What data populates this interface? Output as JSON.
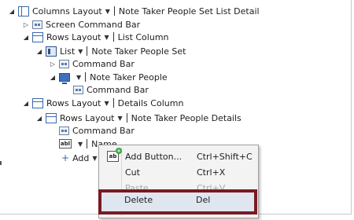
{
  "tree": {
    "root": {
      "icon": "columns-layout-icon",
      "control": "Columns Layout",
      "label": "Note Taker People Set List Detail"
    },
    "screen_command_bar": "Screen Command Bar",
    "rows1": {
      "control": "Rows Layout",
      "label": "List Column"
    },
    "list": {
      "control": "List",
      "label": "Note Taker People Set"
    },
    "list_command_bar": "Command Bar",
    "item": {
      "label": "Note Taker People"
    },
    "item_command_bar": "Command Bar",
    "rows2": {
      "control": "Rows Layout",
      "label": "Details Column"
    },
    "rows3": {
      "control": "Rows Layout",
      "label": "Note Taker People Details"
    },
    "details_command_bar": "Command Bar",
    "name_field": {
      "icon_text": "abl",
      "label": "Name"
    },
    "add": "Add"
  },
  "context_menu": {
    "items": [
      {
        "label": "Add Button...",
        "shortcut": "Ctrl+Shift+C",
        "enabled": true,
        "icon": "add-button-icon"
      },
      {
        "label": "Cut",
        "shortcut": "Ctrl+X",
        "enabled": true
      },
      {
        "label": "Paste",
        "shortcut": "Ctrl+V",
        "enabled": false
      },
      {
        "label": "Delete",
        "shortcut": "Del",
        "enabled": true,
        "highlighted": true
      }
    ]
  },
  "colors": {
    "highlight_border": "#7a1a22",
    "accent": "#3a6aa8"
  }
}
